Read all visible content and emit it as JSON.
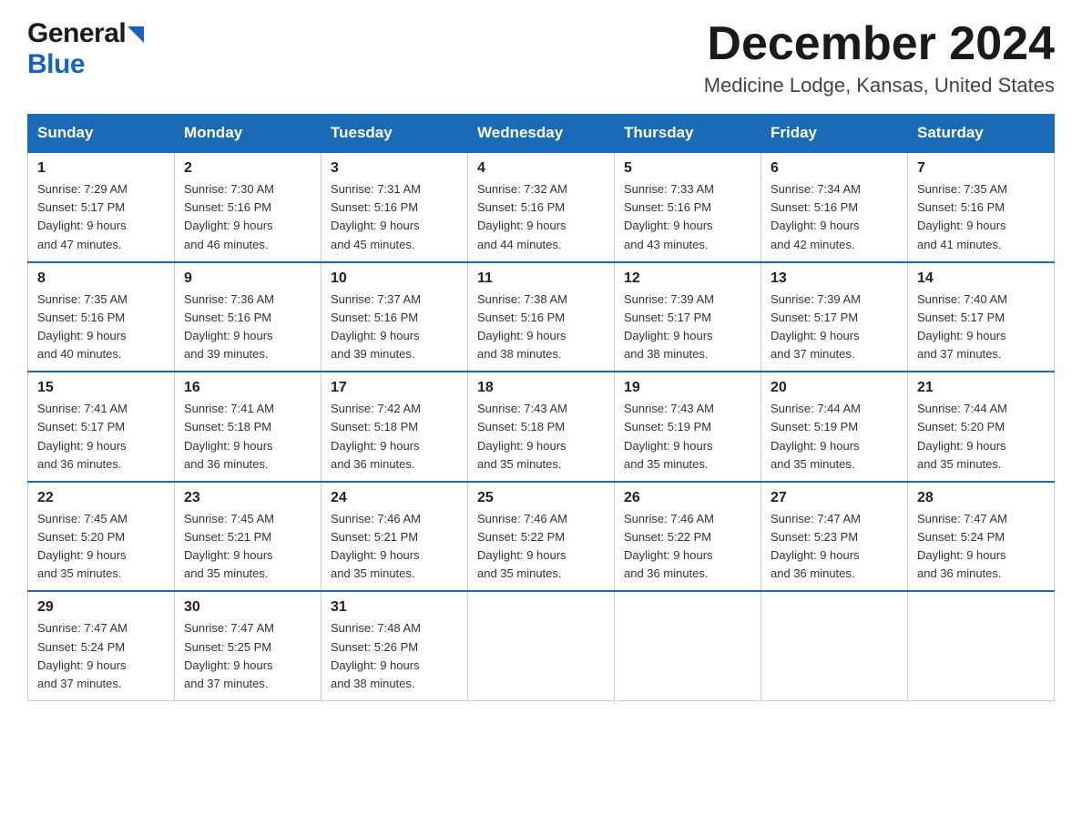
{
  "header": {
    "logo_general": "General",
    "logo_blue": "Blue",
    "month_title": "December 2024",
    "location": "Medicine Lodge, Kansas, United States"
  },
  "days_of_week": [
    "Sunday",
    "Monday",
    "Tuesday",
    "Wednesday",
    "Thursday",
    "Friday",
    "Saturday"
  ],
  "weeks": [
    [
      {
        "day": "1",
        "sunrise": "7:29 AM",
        "sunset": "5:17 PM",
        "daylight": "9 hours and 47 minutes."
      },
      {
        "day": "2",
        "sunrise": "7:30 AM",
        "sunset": "5:16 PM",
        "daylight": "9 hours and 46 minutes."
      },
      {
        "day": "3",
        "sunrise": "7:31 AM",
        "sunset": "5:16 PM",
        "daylight": "9 hours and 45 minutes."
      },
      {
        "day": "4",
        "sunrise": "7:32 AM",
        "sunset": "5:16 PM",
        "daylight": "9 hours and 44 minutes."
      },
      {
        "day": "5",
        "sunrise": "7:33 AM",
        "sunset": "5:16 PM",
        "daylight": "9 hours and 43 minutes."
      },
      {
        "day": "6",
        "sunrise": "7:34 AM",
        "sunset": "5:16 PM",
        "daylight": "9 hours and 42 minutes."
      },
      {
        "day": "7",
        "sunrise": "7:35 AM",
        "sunset": "5:16 PM",
        "daylight": "9 hours and 41 minutes."
      }
    ],
    [
      {
        "day": "8",
        "sunrise": "7:35 AM",
        "sunset": "5:16 PM",
        "daylight": "9 hours and 40 minutes."
      },
      {
        "day": "9",
        "sunrise": "7:36 AM",
        "sunset": "5:16 PM",
        "daylight": "9 hours and 39 minutes."
      },
      {
        "day": "10",
        "sunrise": "7:37 AM",
        "sunset": "5:16 PM",
        "daylight": "9 hours and 39 minutes."
      },
      {
        "day": "11",
        "sunrise": "7:38 AM",
        "sunset": "5:16 PM",
        "daylight": "9 hours and 38 minutes."
      },
      {
        "day": "12",
        "sunrise": "7:39 AM",
        "sunset": "5:17 PM",
        "daylight": "9 hours and 38 minutes."
      },
      {
        "day": "13",
        "sunrise": "7:39 AM",
        "sunset": "5:17 PM",
        "daylight": "9 hours and 37 minutes."
      },
      {
        "day": "14",
        "sunrise": "7:40 AM",
        "sunset": "5:17 PM",
        "daylight": "9 hours and 37 minutes."
      }
    ],
    [
      {
        "day": "15",
        "sunrise": "7:41 AM",
        "sunset": "5:17 PM",
        "daylight": "9 hours and 36 minutes."
      },
      {
        "day": "16",
        "sunrise": "7:41 AM",
        "sunset": "5:18 PM",
        "daylight": "9 hours and 36 minutes."
      },
      {
        "day": "17",
        "sunrise": "7:42 AM",
        "sunset": "5:18 PM",
        "daylight": "9 hours and 36 minutes."
      },
      {
        "day": "18",
        "sunrise": "7:43 AM",
        "sunset": "5:18 PM",
        "daylight": "9 hours and 35 minutes."
      },
      {
        "day": "19",
        "sunrise": "7:43 AM",
        "sunset": "5:19 PM",
        "daylight": "9 hours and 35 minutes."
      },
      {
        "day": "20",
        "sunrise": "7:44 AM",
        "sunset": "5:19 PM",
        "daylight": "9 hours and 35 minutes."
      },
      {
        "day": "21",
        "sunrise": "7:44 AM",
        "sunset": "5:20 PM",
        "daylight": "9 hours and 35 minutes."
      }
    ],
    [
      {
        "day": "22",
        "sunrise": "7:45 AM",
        "sunset": "5:20 PM",
        "daylight": "9 hours and 35 minutes."
      },
      {
        "day": "23",
        "sunrise": "7:45 AM",
        "sunset": "5:21 PM",
        "daylight": "9 hours and 35 minutes."
      },
      {
        "day": "24",
        "sunrise": "7:46 AM",
        "sunset": "5:21 PM",
        "daylight": "9 hours and 35 minutes."
      },
      {
        "day": "25",
        "sunrise": "7:46 AM",
        "sunset": "5:22 PM",
        "daylight": "9 hours and 35 minutes."
      },
      {
        "day": "26",
        "sunrise": "7:46 AM",
        "sunset": "5:22 PM",
        "daylight": "9 hours and 36 minutes."
      },
      {
        "day": "27",
        "sunrise": "7:47 AM",
        "sunset": "5:23 PM",
        "daylight": "9 hours and 36 minutes."
      },
      {
        "day": "28",
        "sunrise": "7:47 AM",
        "sunset": "5:24 PM",
        "daylight": "9 hours and 36 minutes."
      }
    ],
    [
      {
        "day": "29",
        "sunrise": "7:47 AM",
        "sunset": "5:24 PM",
        "daylight": "9 hours and 37 minutes."
      },
      {
        "day": "30",
        "sunrise": "7:47 AM",
        "sunset": "5:25 PM",
        "daylight": "9 hours and 37 minutes."
      },
      {
        "day": "31",
        "sunrise": "7:48 AM",
        "sunset": "5:26 PM",
        "daylight": "9 hours and 38 minutes."
      },
      null,
      null,
      null,
      null
    ]
  ],
  "labels": {
    "sunrise": "Sunrise:",
    "sunset": "Sunset:",
    "daylight": "Daylight:"
  }
}
